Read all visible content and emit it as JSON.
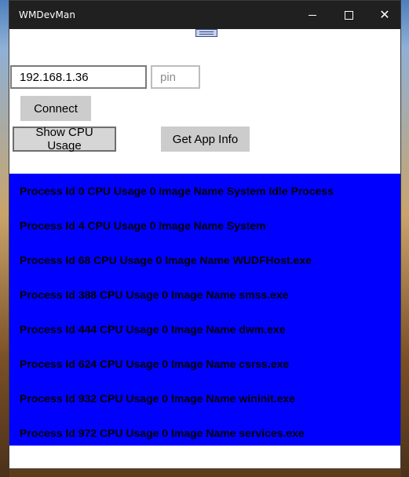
{
  "window": {
    "title": "WMDevMan"
  },
  "connection": {
    "ip_value": "192.168.1.36",
    "pin_placeholder": "pin",
    "connect_label": "Connect"
  },
  "actions": {
    "cpu_label": "Show CPU Usage",
    "appinfo_label": "Get App Info"
  },
  "processes": [
    "Process Id 0  CPU Usage 0  Image Name System Idle Process",
    "Process Id 4  CPU Usage 0  Image Name System",
    "Process Id 68  CPU Usage 0  Image Name WUDFHost.exe",
    "Process Id 388  CPU Usage 0  Image Name smss.exe",
    "Process Id 444  CPU Usage 0  Image Name dwm.exe",
    "Process Id 624  CPU Usage 0  Image Name csrss.exe",
    "Process Id 932  CPU Usage 0  Image Name wininit.exe",
    "Process Id 972  CPU Usage 0  Image Name services.exe"
  ],
  "icons": {
    "minimize": "minimize-icon",
    "maximize": "maximize-icon",
    "close": "close-icon",
    "handle": "drag-handle-icon"
  },
  "colors": {
    "titlebar": "#202020",
    "list_background": "#0000ff",
    "button": "#cccccc"
  }
}
